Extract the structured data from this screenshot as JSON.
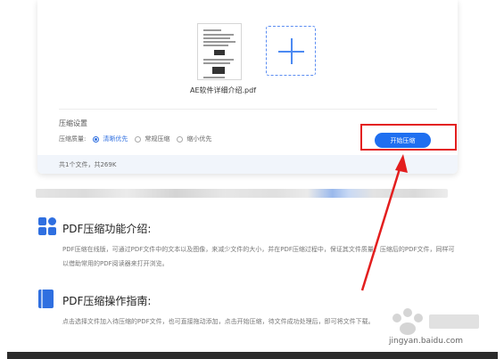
{
  "upload": {
    "file_name": "AE软件详细介绍.pdf",
    "add_label": "+"
  },
  "settings": {
    "title": "压缩设置",
    "quality_label": "压缩质量:",
    "options": [
      "清晰优先",
      "常规压缩",
      "缩小优先"
    ],
    "selected": "清晰优先",
    "start_button": "开始压缩"
  },
  "summary": "共1个文件，共269K",
  "section1": {
    "title": "PDF压缩功能介绍:",
    "body": "PDF压缩在线版，可通过PDF文件中的文本以及图像，来减少文件的大小，并在PDF压缩过程中，保证其文件质量。压缩后的PDF文件，同样可以借助常用的PDF阅读器来打开浏览。"
  },
  "section2": {
    "title": "PDF压缩操作指南:",
    "body": "点击选择文件加入待压缩的PDF文件，也可直接拖动添加，点击开始压缩，待文件成功处理后，即可将文件下载。"
  },
  "watermark": "jingyan.baidu.com",
  "colors": {
    "accent": "#1f6ff0",
    "highlight": "#e31e1e"
  }
}
